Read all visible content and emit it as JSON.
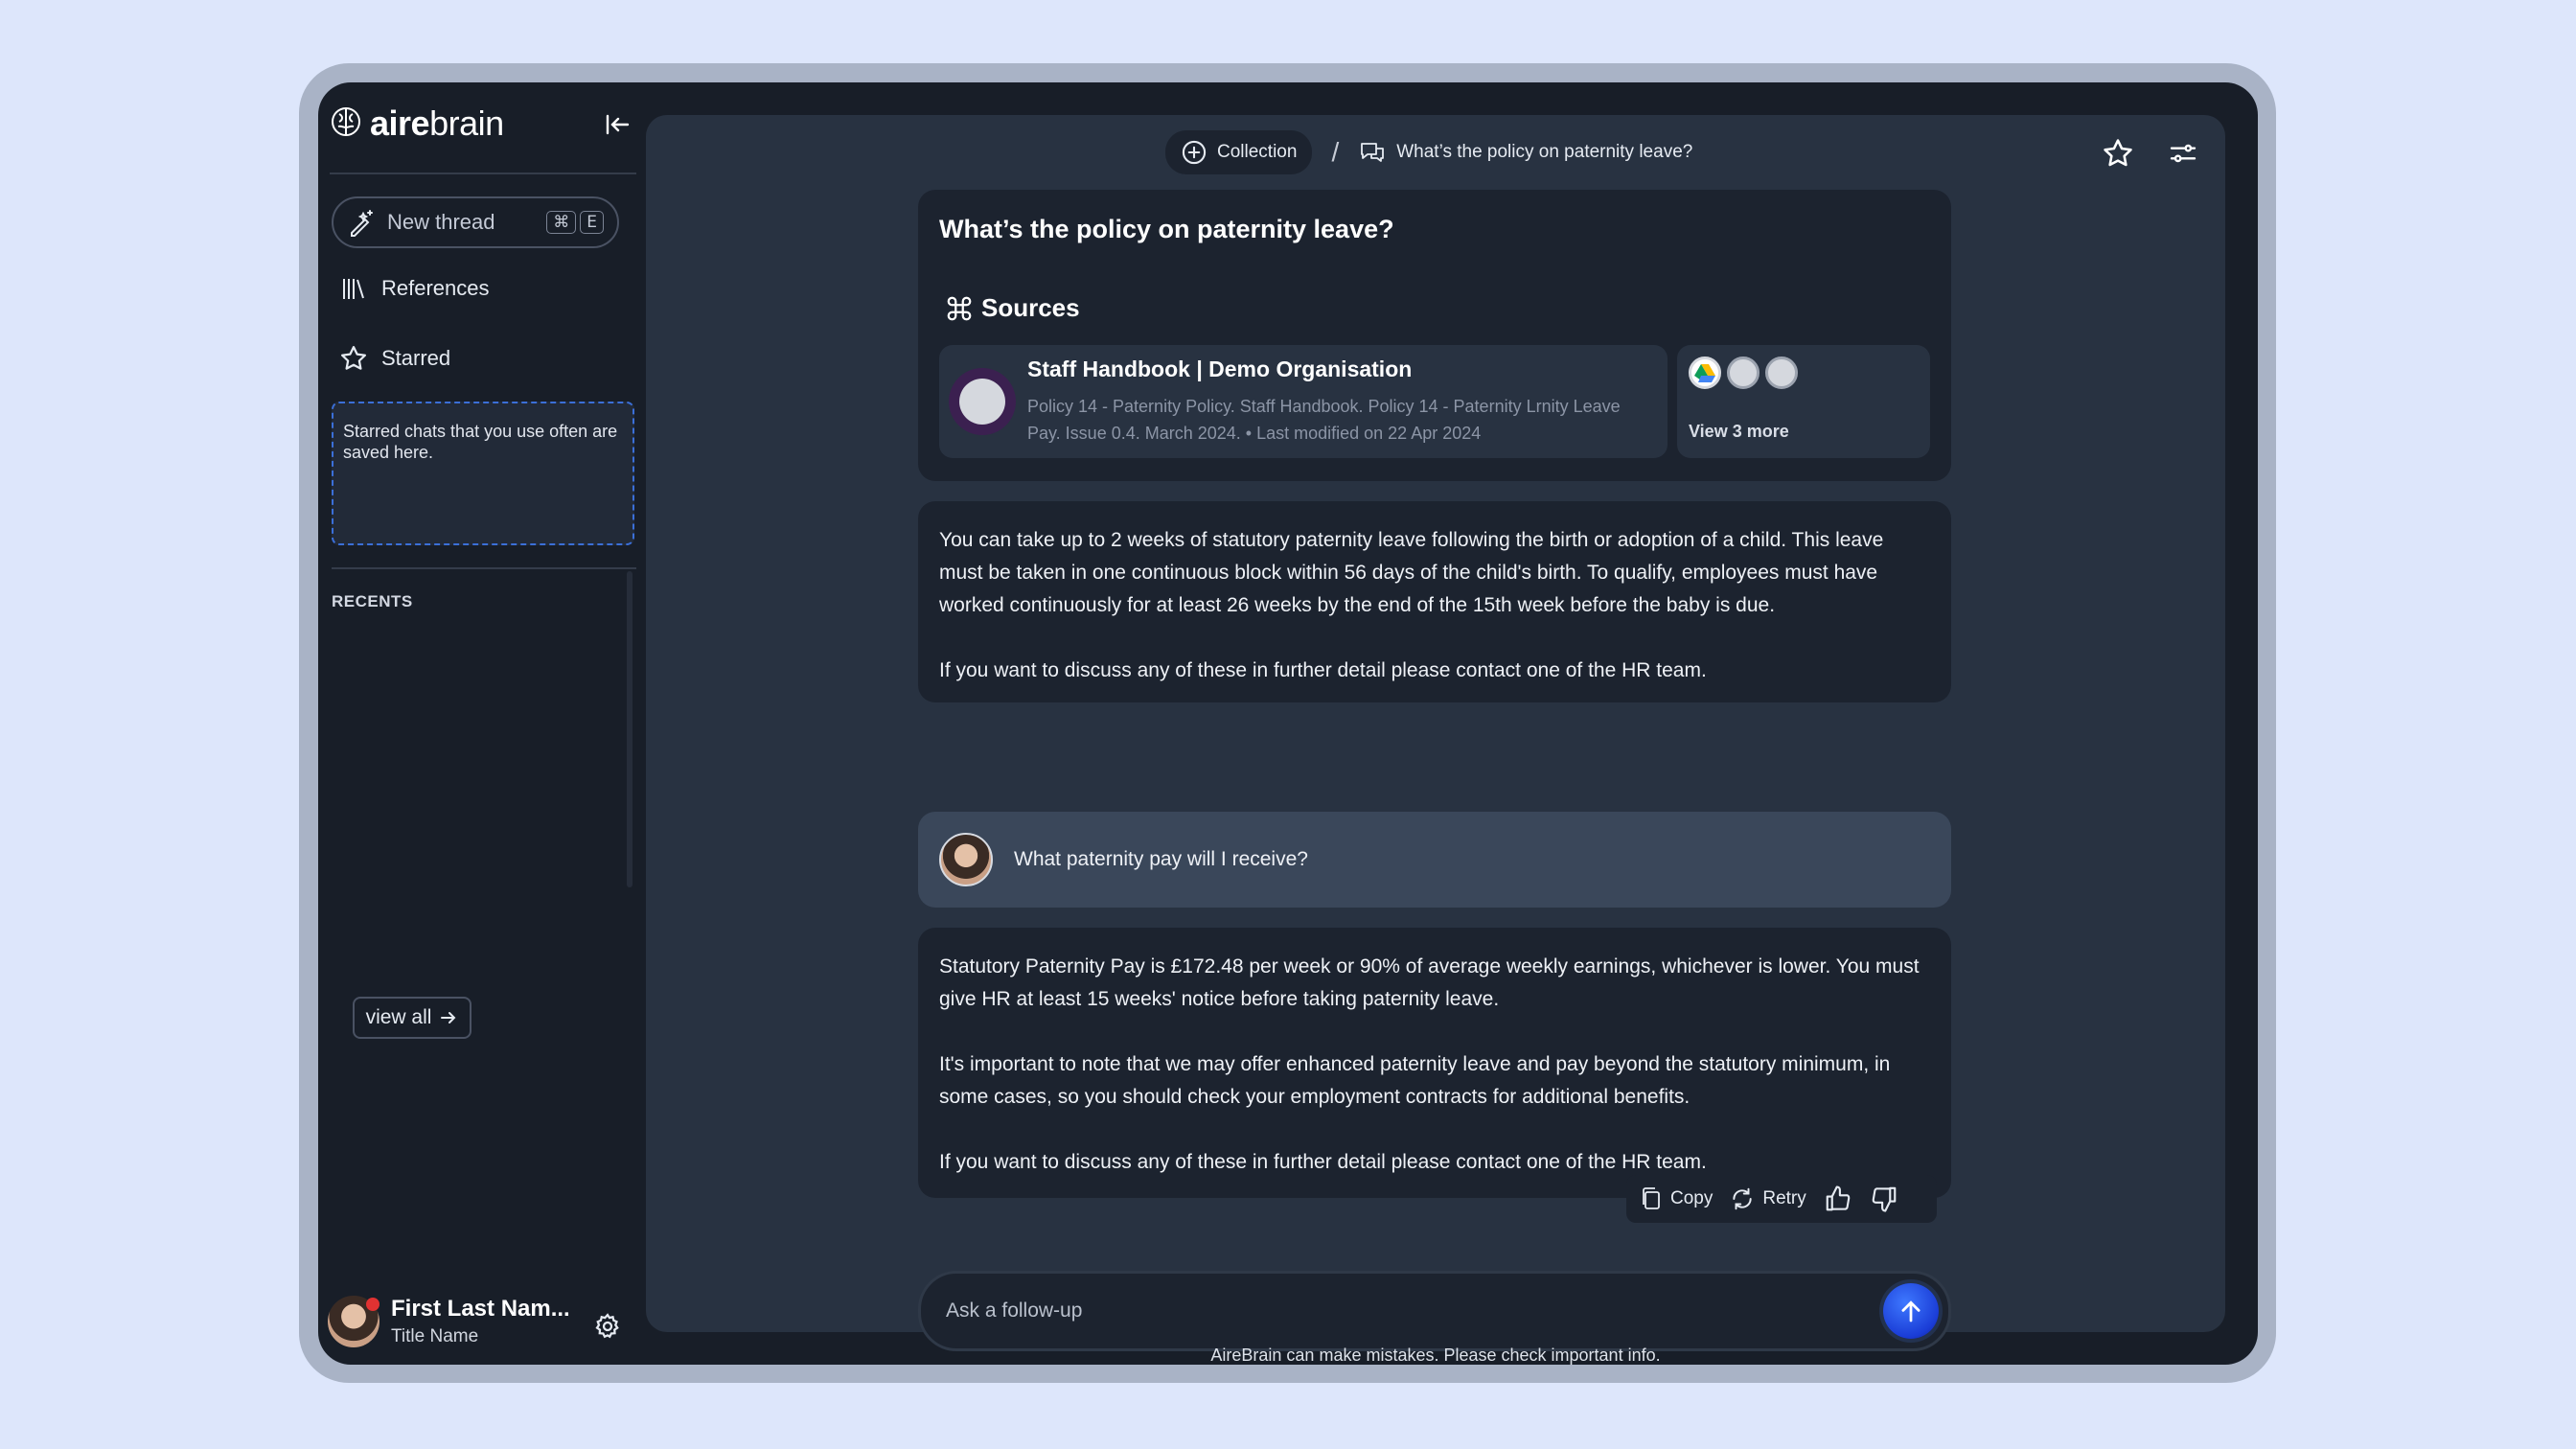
{
  "app": {
    "logo_bold": "aire",
    "logo_light": "brain"
  },
  "sidebar": {
    "new_thread_label": "New thread",
    "shortcut_keys": [
      "⌘",
      "E"
    ],
    "references_label": "References",
    "starred_label": "Starred",
    "starred_hint": "Starred chats that you use often are saved here.",
    "recents_label": "RECENTS",
    "view_all_label": "view all"
  },
  "user": {
    "name": "First Last Nam...",
    "title": "Title Name"
  },
  "header": {
    "collection_label": "Collection",
    "separator": "/",
    "thread_title": "What’s the policy on paternity leave?"
  },
  "thread": {
    "question": "What’s the policy on paternity leave?",
    "sources_label": "Sources",
    "source": {
      "title": "Staff Handbook | Demo Organisation",
      "desc_line1": "Policy 14 - Paternity Policy. Staff Handbook. Policy 14 - Paternity Lrnity Leave",
      "desc_line2": "Pay. Issue 0.4. March 2024. • Last modified on 22 Apr 2024"
    },
    "view_more_label": "View 3 more",
    "answer1": [
      "You can take up to 2 weeks of statutory paternity leave following the birth or adoption of a child. This leave must be taken in one continuous block within 56 days of the child's birth. To qualify, employees must have worked continuously for at least 26 weeks by the end of the 15th week before the baby is due.",
      "If you want to discuss any of these in further detail please contact one of the HR team."
    ],
    "followup_question": "What paternity pay will I receive?",
    "answer2": [
      "Statutory Paternity Pay is £172.48 per week or 90% of average weekly earnings, whichever is lower. You must give HR at least 15 weeks' notice before taking paternity leave.",
      "It's important to note that we may offer enhanced paternity leave and pay beyond the statutory minimum, in some cases, so you should check your employment contracts for additional benefits.",
      "If you want to discuss any of these in further detail please contact one of the HR team."
    ],
    "actions": {
      "copy_label": "Copy",
      "retry_label": "Retry"
    }
  },
  "composer": {
    "placeholder": "Ask a follow-up",
    "value": "",
    "disclaimer": "AireBrain can make mistakes. Please check important info."
  },
  "help_label": "?",
  "colors": {
    "accent": "#1f5cff",
    "dashed_border": "#3b6fd8",
    "source_icon_bg": "#3b2050"
  }
}
